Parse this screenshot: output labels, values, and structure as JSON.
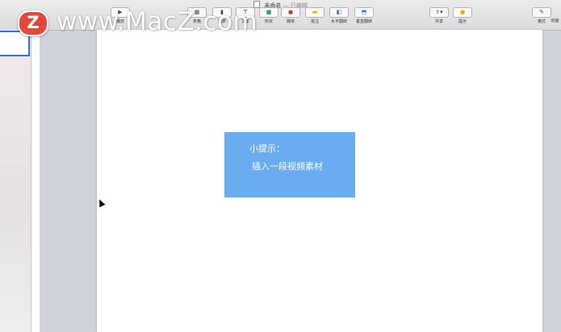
{
  "window": {
    "title": "未命名",
    "edited_status": "— 已编辑"
  },
  "toolbar": {
    "play_label": "播放",
    "table_label": "表格",
    "chart_label": "图表",
    "text_label": "文本",
    "shape_label": "形状",
    "media_label": "媒体",
    "comment_label": "批注",
    "flip_h_label": "水平翻转",
    "flip_v_label": "垂直翻转",
    "share_label": "共享",
    "tips_label": "提示",
    "format_label": "格式",
    "animate_label": "动画"
  },
  "watermark": {
    "logo_letter": "Z",
    "text": "www.MacZ.com"
  },
  "slide": {
    "tip_title": "小提示：",
    "tip_body": "插入一段视频素材"
  },
  "colors": {
    "tip_box": "#6aacf0",
    "selection_border": "#3a6fd8",
    "watermark_logo": "#e44839"
  }
}
